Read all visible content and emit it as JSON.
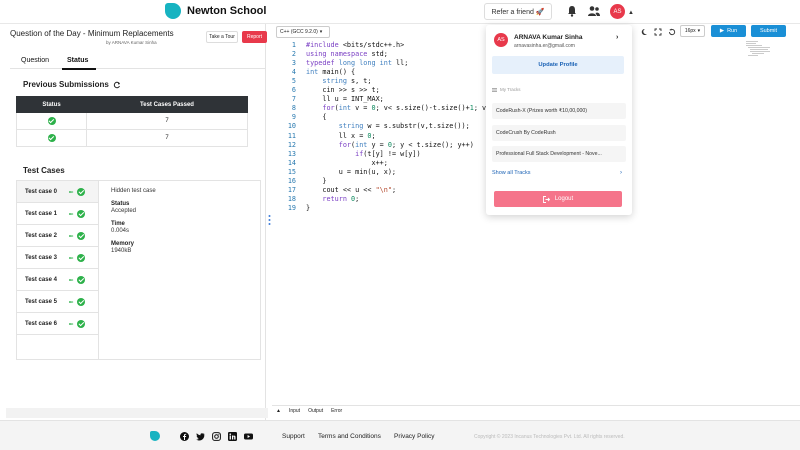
{
  "header": {
    "brand": "Newton School",
    "refer_button": "Refer a friend 🚀",
    "avatar_initials": "AS"
  },
  "question": {
    "title": "Question of the Day - Minimum Replacements",
    "author": "by ARNAVA Kumar Sinha",
    "take_tour": "Take a Tour",
    "report": "Report"
  },
  "tabs": [
    {
      "label": "Question",
      "active": false
    },
    {
      "label": "Status",
      "active": true
    }
  ],
  "previous_submissions": {
    "title": "Previous Submissions",
    "columns": [
      "Status",
      "Test Cases Passed"
    ],
    "rows": [
      {
        "status": "passed",
        "passed": "7"
      },
      {
        "status": "passed",
        "passed": "7"
      }
    ]
  },
  "test_cases": {
    "title": "Test Cases",
    "items": [
      {
        "label": "Test case 0",
        "time": "ac"
      },
      {
        "label": "Test case 1",
        "time": "ac"
      },
      {
        "label": "Test case 2",
        "time": "ac"
      },
      {
        "label": "Test case 3",
        "time": "ac"
      },
      {
        "label": "Test case 4",
        "time": "ac"
      },
      {
        "label": "Test case 5",
        "time": "ac"
      },
      {
        "label": "Test case 6",
        "time": "ac"
      }
    ],
    "detail": {
      "heading": "Hidden test case",
      "status_label": "Status",
      "status_value": "Accepted",
      "time_label": "Time",
      "time_value": "0.004s",
      "memory_label": "Memory",
      "memory_value": "1940kB"
    }
  },
  "editor": {
    "language": "C++ (GCC 9.2.0)",
    "font_size": "16px",
    "run": "Run",
    "submit": "Submit",
    "io_tabs": [
      "Input",
      "Output",
      "Error"
    ]
  },
  "dropdown": {
    "initials": "AS",
    "name": "ARNAVA Kumar Sinha",
    "email": "arnavasinha.er@gmail.com",
    "update_profile": "Update Profile",
    "tracks_heading": "My Tracks",
    "tracks": [
      "CodeRush-X (Prizes worth ₹10,00,000)",
      "CodeCrush By CodeRush",
      "Professional Full Stack Development - Nove..."
    ],
    "show_all": "Show all Tracks",
    "logout": "Logout"
  },
  "footer": {
    "links": [
      "Support",
      "Terms and Conditions",
      "Privacy Policy"
    ],
    "copyright": "Copyright © 2023 Incanus Technologies Pvt. Ltd. All rights reserved."
  },
  "colors": {
    "accent": "#1a8fd6",
    "brand": "#17b3c1",
    "danger": "#e8394b",
    "success": "#2db14a"
  }
}
